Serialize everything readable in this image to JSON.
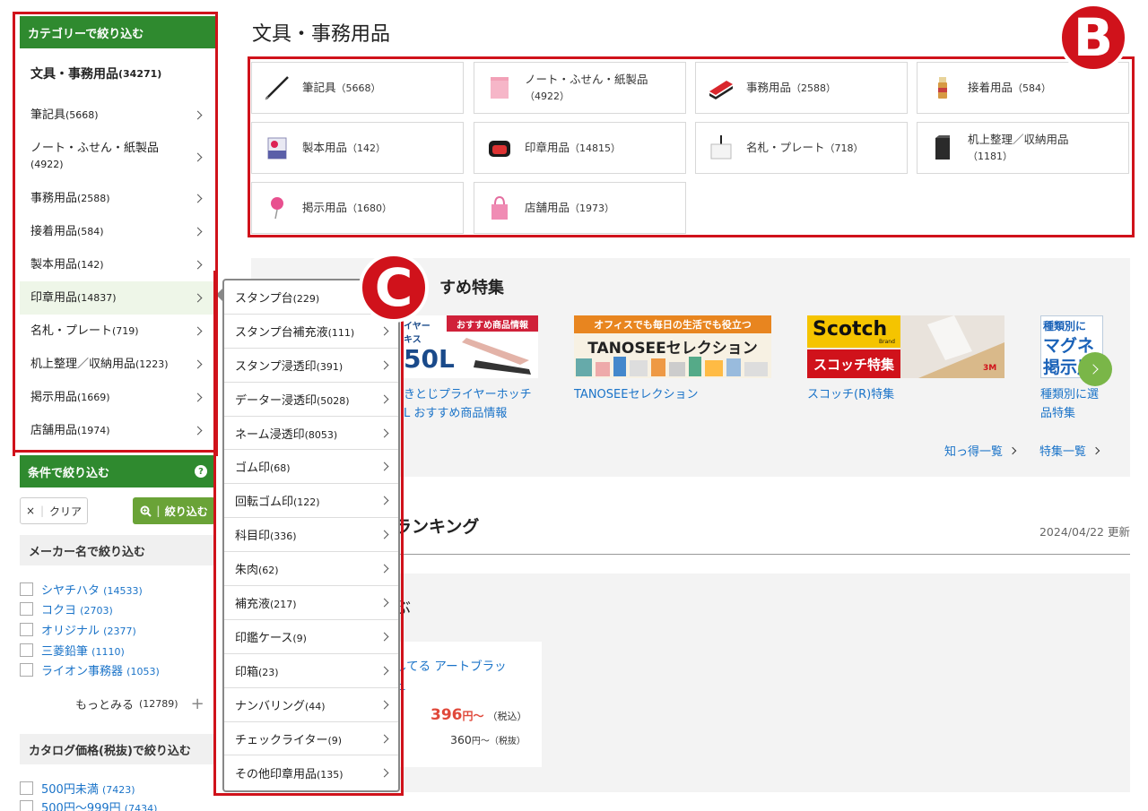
{
  "sidebar": {
    "category_header": "カテゴリーで絞り込む",
    "root": {
      "label": "文具・事務用品",
      "count": "(34271)"
    },
    "items": [
      {
        "label": "筆記具",
        "count": "(5668)"
      },
      {
        "label": "ノート・ふせん・紙製品",
        "count": "(4922)"
      },
      {
        "label": "事務用品",
        "count": "(2588)"
      },
      {
        "label": "接着用品",
        "count": "(584)"
      },
      {
        "label": "製本用品",
        "count": "(142)"
      },
      {
        "label": "印章用品",
        "count": "(14837)"
      },
      {
        "label": "名札・プレート",
        "count": "(719)"
      },
      {
        "label": "机上整理／収納用品",
        "count": "(1223)"
      },
      {
        "label": "掲示用品",
        "count": "(1669)"
      },
      {
        "label": "店舗用品",
        "count": "(1974)"
      }
    ],
    "condition_header": "条件で絞り込む",
    "help": "?",
    "clear_icon": "×",
    "clear_label": "クリア",
    "filter_label": "絞り込む",
    "maker_header": "メーカー名で絞り込む",
    "makers": [
      {
        "label": "シヤチハタ",
        "count": "(14533)"
      },
      {
        "label": "コクヨ",
        "count": "(2703)"
      },
      {
        "label": "オリジナル",
        "count": "(2377)"
      },
      {
        "label": "三菱鉛筆",
        "count": "(1110)"
      },
      {
        "label": "ライオン事務器",
        "count": "(1053)"
      }
    ],
    "more_label": "もっとみる",
    "more_count": "(12789)",
    "price_header": "カタログ価格(税抜)で絞り込む",
    "prices": [
      {
        "label": "500円未満",
        "count": "(7423)"
      },
      {
        "label": "500円〜999円",
        "count": "(7434)"
      }
    ]
  },
  "main": {
    "title": "文具・事務用品",
    "tiles": [
      {
        "label": "筆記具",
        "count": "（5668）",
        "icon": "pen-icon"
      },
      {
        "label": "ノート・ふせん・紙製品",
        "count": "（4922）",
        "icon": "sticky-note-icon"
      },
      {
        "label": "事務用品",
        "count": "（2588）",
        "icon": "stapler-icon"
      },
      {
        "label": "接着用品",
        "count": "（584）",
        "icon": "glue-stick-icon"
      },
      {
        "label": "製本用品",
        "count": "（142）",
        "icon": "binding-tape-icon"
      },
      {
        "label": "印章用品",
        "count": "（14815）",
        "icon": "stamp-pad-icon"
      },
      {
        "label": "名札・プレート",
        "count": "（718）",
        "icon": "name-badge-icon"
      },
      {
        "label": "机上整理／収納用品",
        "count": "（1181）",
        "icon": "file-box-icon"
      },
      {
        "label": "掲示用品",
        "count": "（1680）",
        "icon": "push-pin-icon"
      },
      {
        "label": "店舗用品",
        "count": "（1973）",
        "icon": "shopping-bag-icon"
      }
    ],
    "feature": {
      "title": "すめ特集",
      "banners": [
        {
          "line1": "おすすめ商品情報",
          "line2": "イヤー",
          "line3": "キス",
          "big": "50L",
          "caption1": "きとじプライヤーホッチ",
          "caption2": "L おすすめ商品情報"
        },
        {
          "line1": "オフィスでも毎日の生活でも役立つ",
          "big": "TANOSEEセレクション",
          "caption1": "TANOSEEセレクション"
        },
        {
          "line1": "Scotch",
          "line2": "Brand",
          "big": "スコッチ特集",
          "line3": "3M",
          "caption1": "スコッチ(R)特集"
        },
        {
          "line1": "種類別に",
          "line2": "マグネ",
          "line3": "掲示用",
          "caption1": "種類別に選",
          "caption2": "品特集"
        }
      ],
      "link_tips": "知っ得一覧",
      "link_features": "特集一覧"
    },
    "ranking": {
      "title": "ランキング",
      "date": "2024/04/22 更新",
      "left_char": "ぶ",
      "product_name_1": "してる アートブラッ",
      "product_name_2": "ュ",
      "price": "396",
      "price_unit": "円〜",
      "price_tax": "（税込）",
      "price_ex": "360",
      "price_ex_unit": "円〜",
      "price_ex_tax": "（税抜）"
    }
  },
  "dropdown": {
    "items": [
      {
        "label": "スタンプ台",
        "count": "(229)"
      },
      {
        "label": "スタンプ台補充液",
        "count": "(111)"
      },
      {
        "label": "スタンプ浸透印",
        "count": "(391)"
      },
      {
        "label": "データー浸透印",
        "count": "(5028)"
      },
      {
        "label": "ネーム浸透印",
        "count": "(8053)"
      },
      {
        "label": "ゴム印",
        "count": "(68)"
      },
      {
        "label": "回転ゴム印",
        "count": "(122)"
      },
      {
        "label": "科目印",
        "count": "(336)"
      },
      {
        "label": "朱肉",
        "count": "(62)"
      },
      {
        "label": "補充液",
        "count": "(217)"
      },
      {
        "label": "印鑑ケース",
        "count": "(9)"
      },
      {
        "label": "印箱",
        "count": "(23)"
      },
      {
        "label": "ナンバリング",
        "count": "(44)"
      },
      {
        "label": "チェックライター",
        "count": "(9)"
      },
      {
        "label": "その他印章用品",
        "count": "(135)"
      }
    ]
  },
  "annotations": {
    "badge_b": "B",
    "badge_c": "C",
    "color": "#d0121b"
  },
  "colors": {
    "accent_green": "#2f8a2f",
    "link_blue": "#1a73c8",
    "price_red": "#e0483a"
  }
}
